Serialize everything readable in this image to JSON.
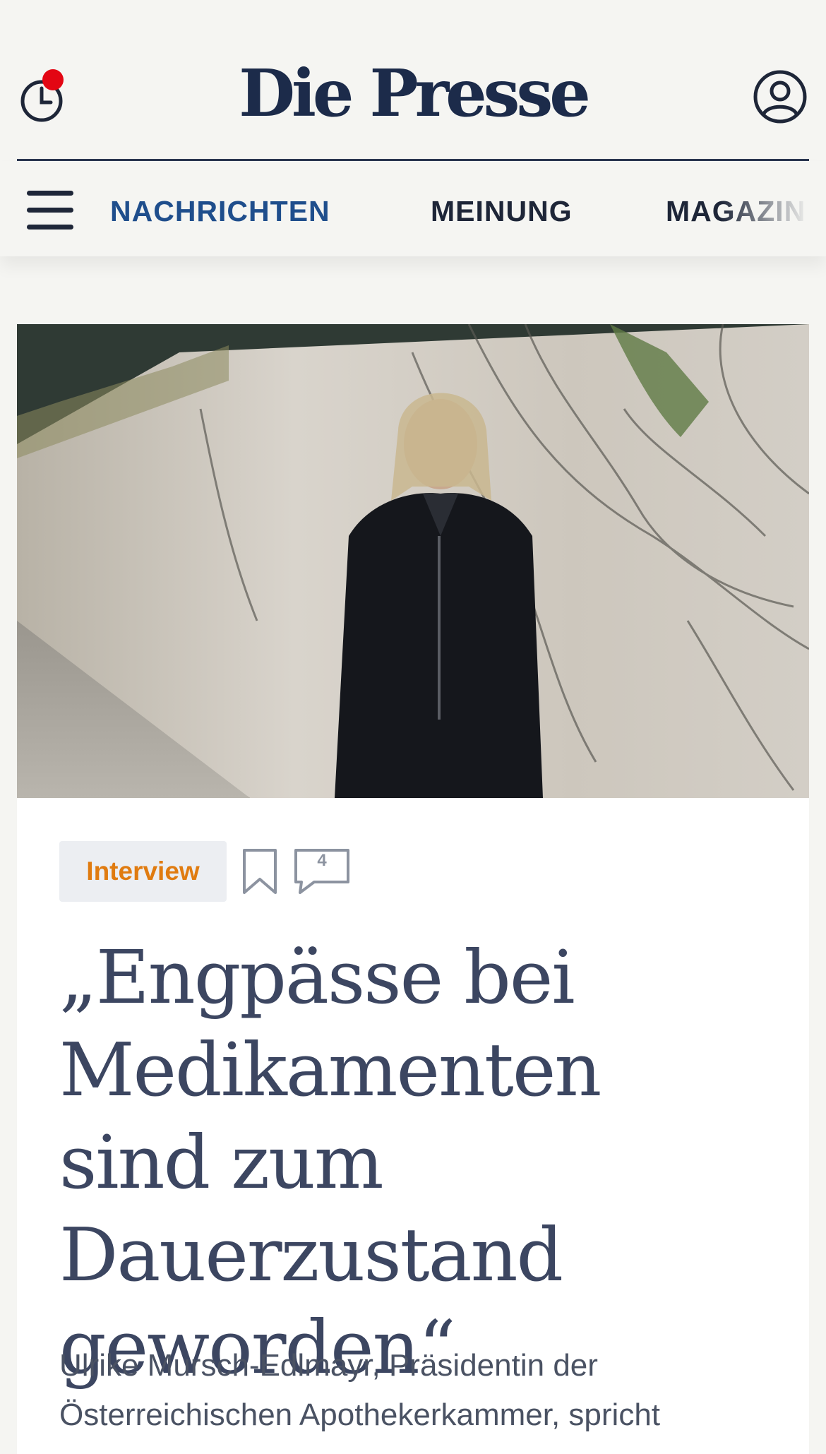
{
  "header": {
    "logo": "Die Presse",
    "history_icon": "clock-history-icon",
    "account_icon": "user-account-icon",
    "notification_color": "#e30613"
  },
  "nav": {
    "items": [
      {
        "label": "NACHRICHTEN",
        "active": true
      },
      {
        "label": "MEINUNG",
        "active": false
      },
      {
        "label": "MAGAZIN",
        "active": false
      }
    ],
    "active_color": "#1f4e8c"
  },
  "article": {
    "badge": "Interview",
    "badge_color": "#e07b10",
    "comment_count": "4",
    "headline": "„Engpässe bei Medikamenten sind zum Dauerzustand geworden“",
    "lead": "Ulrike Mursch-Edlmayr, Präsidentin der Österreichischen Apothekerkammer, spricht"
  }
}
